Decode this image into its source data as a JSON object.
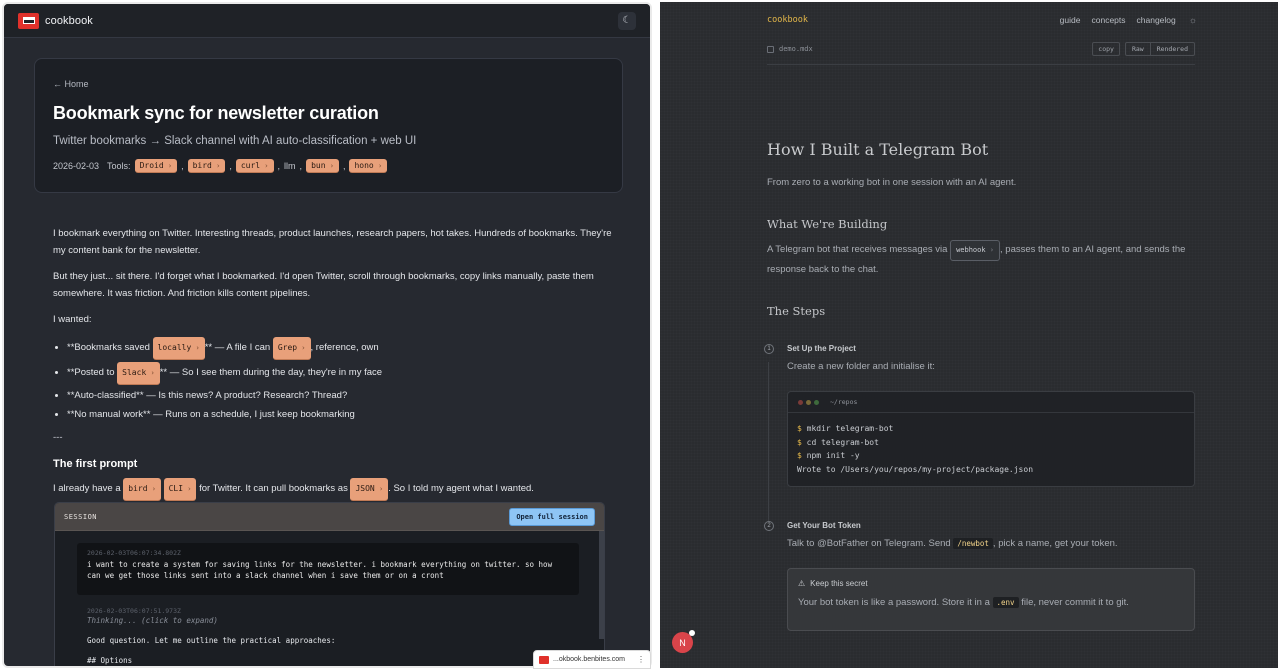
{
  "left": {
    "brand": "cookbook",
    "back": "← Home",
    "title": "Bookmark sync for newsletter curation",
    "subtitle": "Twitter bookmarks → Slack channel with AI auto-classification + web UI",
    "date": "2026-02-03",
    "tools_label": "Tools:",
    "tools": [
      "Droid",
      "bird",
      "curl",
      "llm",
      "bun",
      "hono"
    ],
    "p1": "I bookmark everything on Twitter. Interesting threads, product launches, research papers, hot takes. Hundreds of bookmarks. They're my content bank for the newsletter.",
    "p2": "But they just... sit there. I'd forget what I bookmarked. I'd open Twitter, scroll through bookmarks, copy links manually, paste them somewhere. It was friction. And friction kills content pipelines.",
    "p3": "I wanted:",
    "list": [
      {
        "pre": "**Bookmarks saved ",
        "chip": "locally",
        "mid": "** — A file I can ",
        "chip2": "Grep",
        "post": ", reference, own"
      },
      {
        "pre": "**Posted to ",
        "chip": "Slack",
        "mid": "** — So I see them during the day, they're in my face"
      },
      {
        "pre": "**Auto-classified** — Is this news? A product? Research? Thread?"
      },
      {
        "pre": "**No manual work** — Runs on a schedule, I just keep bookmarking"
      }
    ],
    "hr": "---",
    "h2": "The first prompt",
    "p4_pre": "I already have a ",
    "p4_chip1": "bird",
    "p4_chip2": "CLI",
    "p4_mid": " for Twitter. It can pull bookmarks as ",
    "p4_chip3": "JSON",
    "p4_post": ". So I told my agent what I wanted.",
    "session": {
      "label": "SESSION",
      "open_label": "Open full session",
      "ts1": "2026-02-03T06:07:34.802Z",
      "msg": "i want to create a system for saving links for the newsletter. i bookmark everything on twitter. so how can we get those links sent into a slack channel when i save them or on a cront",
      "ts2": "2026-02-03T06:07:51.973Z",
      "thinking": "Thinking... (click to expand)",
      "reply": "Good question. Let me outline the practical approaches:",
      "reply2": "## Options"
    }
  },
  "right": {
    "brand": "cookbook",
    "nav": [
      "guide",
      "concepts",
      "changelog"
    ],
    "file": "demo.mdx",
    "copy": "copy",
    "seg": [
      "Raw",
      "Rendered"
    ],
    "title": "How I Built a Telegram Bot",
    "lead": "From zero to a working bot in one session with an AI agent.",
    "h2a": "What We're Building",
    "para_pre": "A Telegram bot that receives messages via ",
    "para_chip": "webhook",
    "para_post": ", passes them to an AI agent, and sends the response back to the chat.",
    "h2b": "The Steps",
    "step1": {
      "num": "1",
      "title": "Set Up the Project",
      "desc": "Create a new folder and initialise it:"
    },
    "terminal": {
      "path": "~/repos",
      "lines": [
        {
          "prompt": "$",
          "text": " mkdir telegram-bot"
        },
        {
          "prompt": "$",
          "text": " cd telegram-bot"
        },
        {
          "prompt": "$",
          "text": " npm init -y"
        },
        {
          "prompt": "",
          "text": "Wrote to /Users/you/repos/my-project/package.json"
        }
      ]
    },
    "step2": {
      "num": "2",
      "title": "Get Your Bot Token",
      "desc_pre": "Talk to @BotFather on Telegram. Send ",
      "desc_code": "/newbot",
      "desc_post": ", pick a name, get your token."
    },
    "secret": {
      "title": "Keep this secret",
      "body_pre": "Your bot token is like a password. Store it in a ",
      "body_code": ".env",
      "body_post": " file, never commit it to git."
    },
    "fab": "N"
  },
  "url_pill": "...okbook.benbites.com"
}
